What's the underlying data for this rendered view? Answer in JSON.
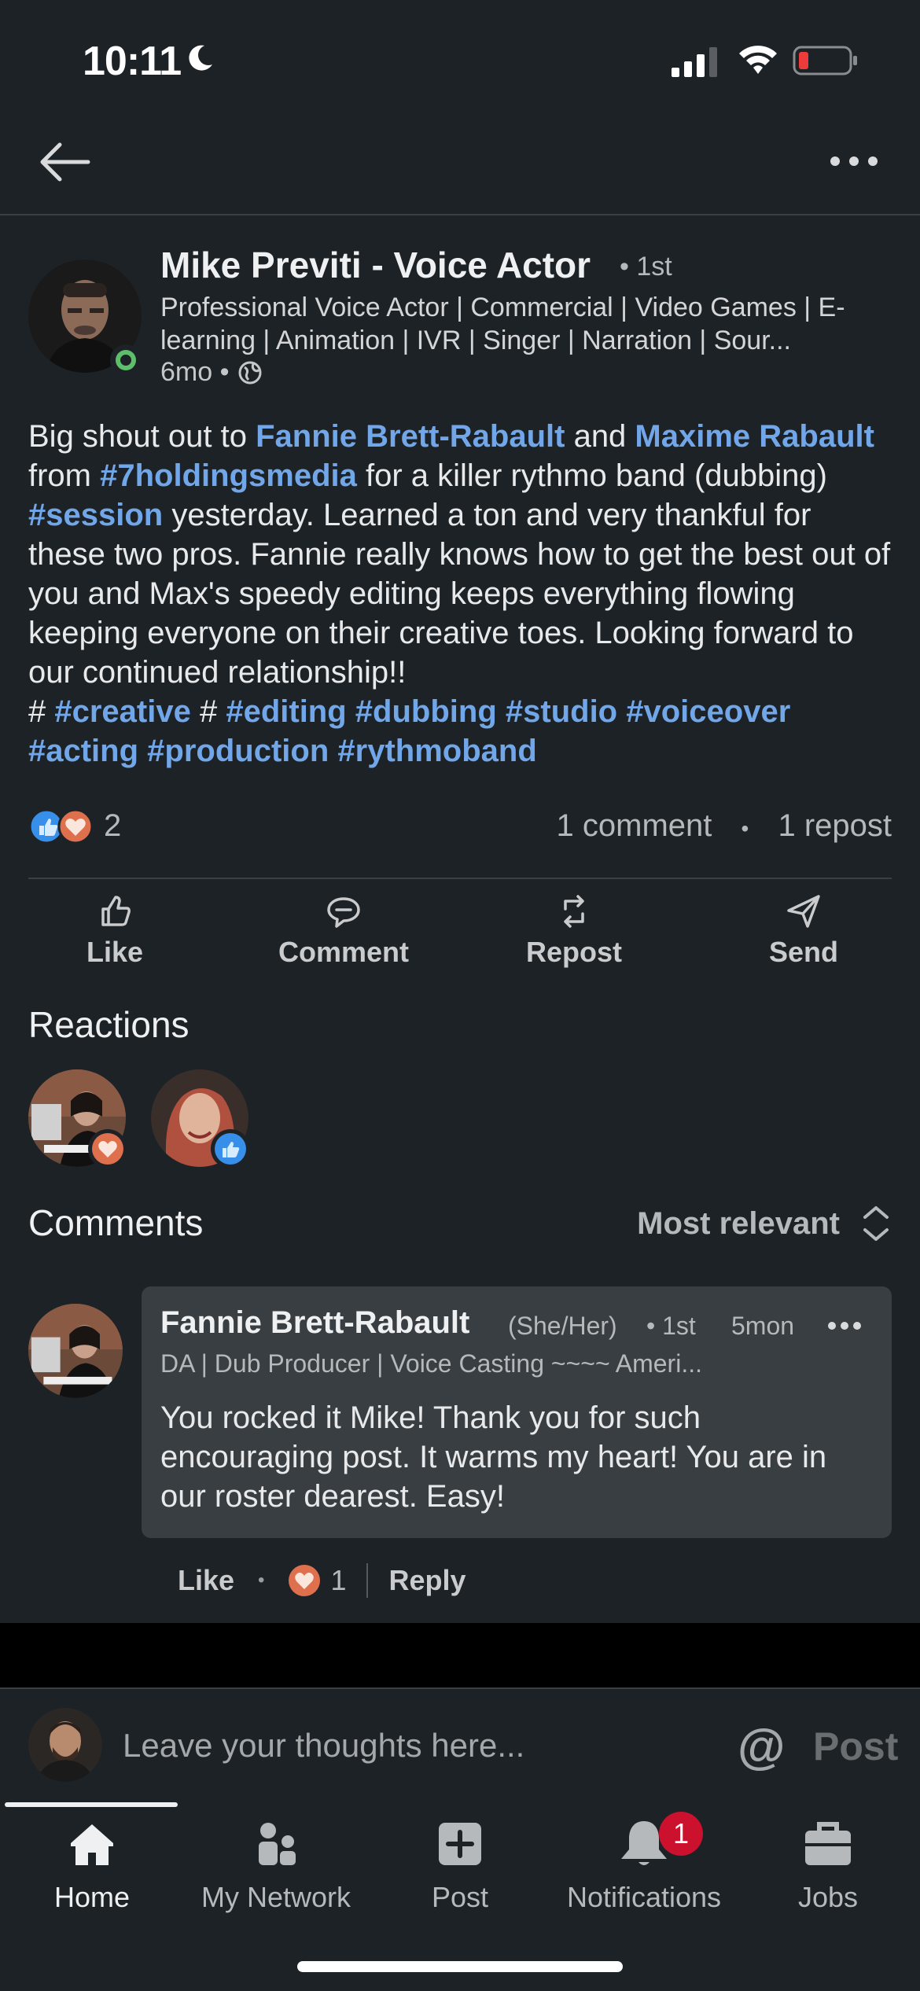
{
  "status_bar": {
    "time": "10:11"
  },
  "post": {
    "author": {
      "name": "Mike Previti - Voice Actor",
      "degree": "• 1st",
      "headline": "Professional Voice Actor | Commercial | Video Games | E-learning | Animation | IVR | Singer | Narration | Sour...",
      "age": "6mo •"
    },
    "body": {
      "t1": "Big shout out to ",
      "m1": "Fannie Brett-Rabault",
      "t2": " and ",
      "m2": "Maxime Rabault",
      "t3": " from ",
      "h1": "#7holdingsmedia",
      "t4": " for a killer rythmo band (dubbing) ",
      "h2": "#session",
      "t5": "  yesterday. Learned a ton and very thankful for these two pros. Fannie really knows how to get the best out of you and Max's speedy editing keeps everything flowing keeping everyone on their creative toes. Looking forward to our continued relationship!!",
      "t6": "# ",
      "h3": "#creative",
      "t7": " # ",
      "h4": "#editing",
      "h5": "#dubbing",
      "h6": "#studio",
      "h7": "#voiceover",
      "h8": "#acting",
      "h9": "#production",
      "h10": "#rythmoband"
    },
    "reaction_count": "2",
    "comment_count": "1 comment",
    "repost_count": "1 repost",
    "actions": {
      "like": "Like",
      "comment": "Comment",
      "repost": "Repost",
      "send": "Send"
    }
  },
  "reactions": {
    "title": "Reactions"
  },
  "comments": {
    "title": "Comments",
    "sort": "Most relevant",
    "items": [
      {
        "name": "Fannie Brett-Rabault",
        "pronouns": "(She/Her)",
        "degree": "• 1st",
        "time": "5mon",
        "headline": "DA | Dub Producer | Voice Casting ~~~~ Ameri...",
        "text": "You rocked it Mike! Thank you for such encouraging post. It warms my heart! You are in our roster dearest. Easy!",
        "like_label": "Like",
        "reaction_count": "1",
        "reply_label": "Reply"
      }
    ]
  },
  "composer": {
    "placeholder": "Leave your thoughts here...",
    "mention": "@",
    "post_label": "Post"
  },
  "tabbar": {
    "home": "Home",
    "network": "My Network",
    "post": "Post",
    "notifications": "Notifications",
    "notifications_badge": "1",
    "jobs": "Jobs"
  },
  "colors": {
    "background": "#1d2226",
    "link": "#71a6e9",
    "online": "#5ebf6b",
    "like_blue": "#378fe9",
    "love_orange": "#df704d",
    "badge_red": "#cb112d"
  }
}
